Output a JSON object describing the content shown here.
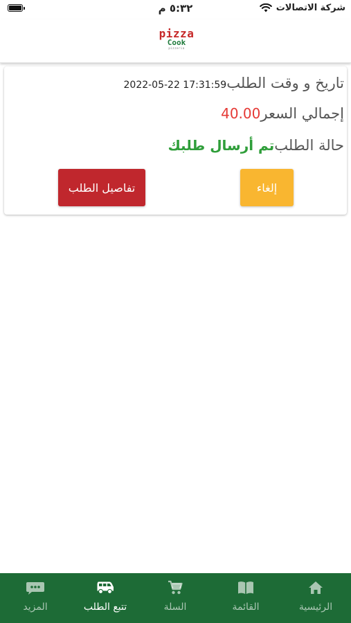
{
  "status_bar": {
    "carrier": "شركة الاتصالات",
    "time": "٥:٣٢ م"
  },
  "header": {
    "logo": {
      "word1": "pizza",
      "word2": "Cook",
      "tagline": "pizzeria"
    }
  },
  "order": {
    "date_label": "تاريخ و وقت الطلب",
    "date_value": "2022-05-22 17:31:59",
    "price_label": "إجمالي السعر",
    "price_value": "40.00",
    "status_label": "حالة الطلب",
    "status_value": "تم أرسال طلبك",
    "cancel_button": "إلغاء",
    "details_button": "تفاصيل الطلب"
  },
  "tabbar": {
    "items": [
      {
        "label": "الرئيسية",
        "icon": "home-icon"
      },
      {
        "label": "القائمة",
        "icon": "book-icon"
      },
      {
        "label": "السلة",
        "icon": "cart-icon"
      },
      {
        "label": "تتبع الطلب",
        "icon": "van-icon"
      },
      {
        "label": "المزيد",
        "icon": "more-icon"
      }
    ],
    "active_index": 3
  },
  "colors": {
    "brand_green": "#1d6b36",
    "price_red": "#e53935",
    "status_green": "#2f9e3a",
    "cancel_yellow": "#f9b630",
    "details_red": "#c0272d"
  }
}
